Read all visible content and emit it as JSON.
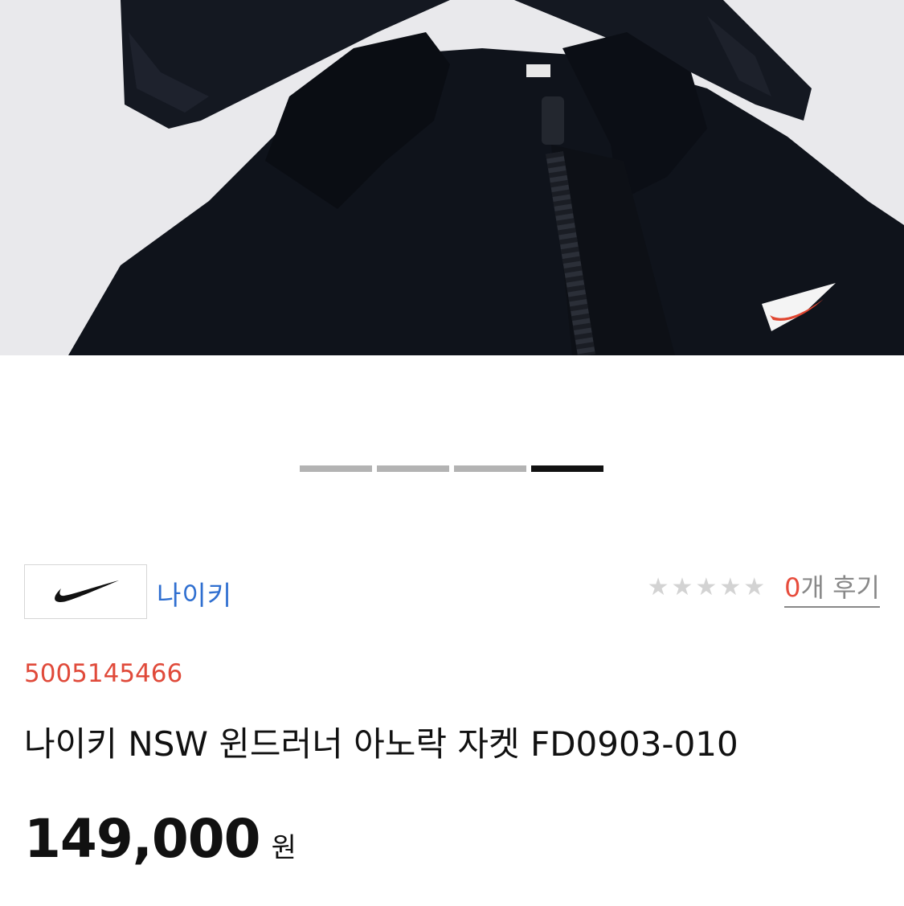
{
  "gallery": {
    "image_alt": "black puffer jacket hood with zipper and embroidered swoosh",
    "pager": [
      {
        "active": false
      },
      {
        "active": false
      },
      {
        "active": false
      },
      {
        "active": true
      }
    ]
  },
  "brand": {
    "logo_icon": "swoosh-logo",
    "name": "나이키"
  },
  "rating": {
    "stars": 0,
    "star_icon": "star-icon",
    "review_count": "0",
    "review_suffix": "개 후기"
  },
  "product": {
    "code": "5005145466",
    "title": "나이키 NSW 윈드러너 아노락 자켓 FD0903-010",
    "price": "149,000",
    "currency": "원"
  },
  "colors": {
    "brand_link": "#2f6fd0",
    "code_red": "#e04a3a",
    "review_count_red": "#e74c3c"
  }
}
